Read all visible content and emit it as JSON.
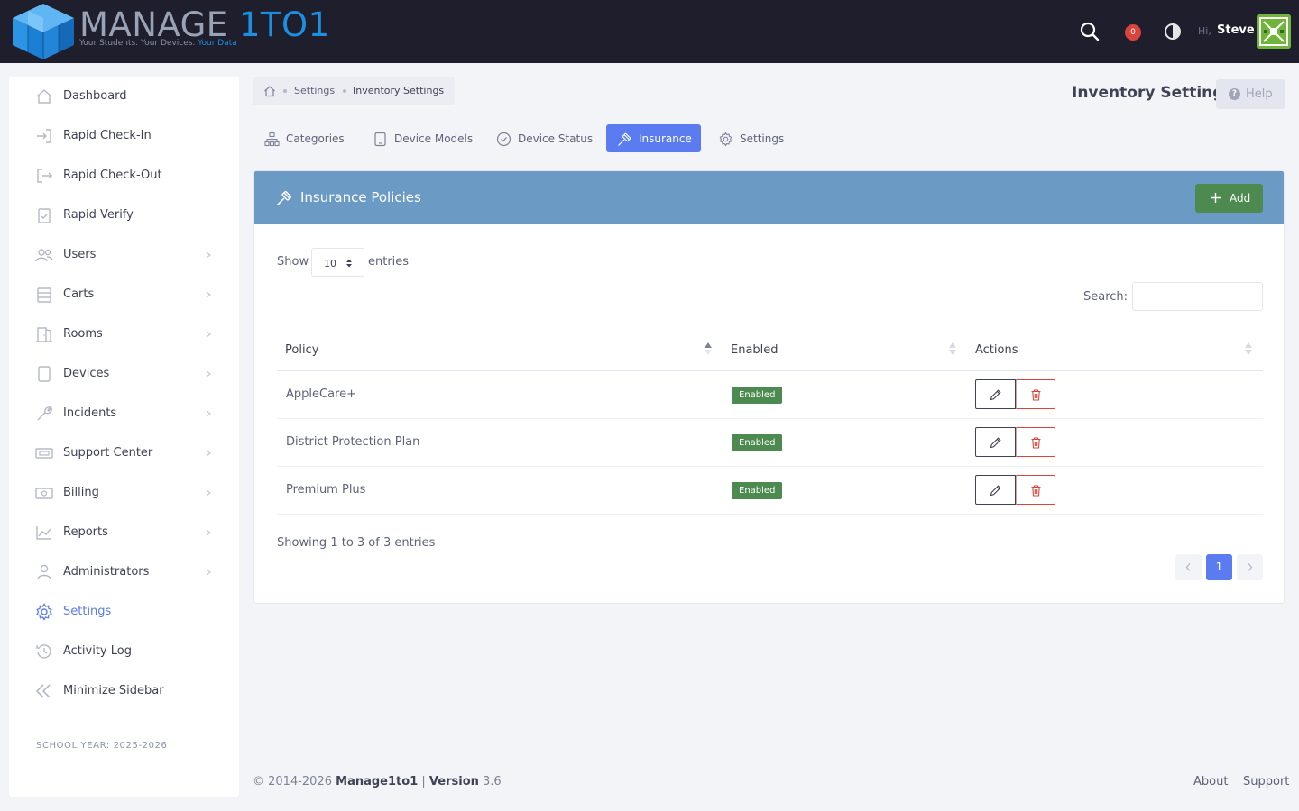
{
  "app": {
    "logo_main": "MANAGE",
    "logo_accent": "1TO1",
    "tagline_main": "Your Students. Your Devices.",
    "tagline_accent": "Your Data"
  },
  "topbar": {
    "notification_count": "0",
    "greeting": "Hi,",
    "user_name": "Steve"
  },
  "sidebar": {
    "items": [
      {
        "label": "Dashboard",
        "icon": "home-icon",
        "has_children": false
      },
      {
        "label": "Rapid Check-In",
        "icon": "sign-in-icon",
        "has_children": false
      },
      {
        "label": "Rapid Check-Out",
        "icon": "sign-out-icon",
        "has_children": false
      },
      {
        "label": "Rapid Verify",
        "icon": "clipboard-check-icon",
        "has_children": false
      },
      {
        "label": "Users",
        "icon": "users-icon",
        "has_children": true
      },
      {
        "label": "Carts",
        "icon": "cart-icon",
        "has_children": true
      },
      {
        "label": "Rooms",
        "icon": "door-icon",
        "has_children": true
      },
      {
        "label": "Devices",
        "icon": "tablet-icon",
        "has_children": true
      },
      {
        "label": "Incidents",
        "icon": "wrench-icon",
        "has_children": true
      },
      {
        "label": "Support Center",
        "icon": "ticket-icon",
        "has_children": true
      },
      {
        "label": "Billing",
        "icon": "money-icon",
        "has_children": true
      },
      {
        "label": "Reports",
        "icon": "chart-icon",
        "has_children": true
      },
      {
        "label": "Administrators",
        "icon": "admin-icon",
        "has_children": true
      },
      {
        "label": "Settings",
        "icon": "gear-icon",
        "has_children": false,
        "active": true
      },
      {
        "label": "Activity Log",
        "icon": "history-icon",
        "has_children": false
      },
      {
        "label": "Minimize Sidebar",
        "icon": "double-chevron-left-icon",
        "has_children": false
      }
    ],
    "school_year": "SCHOOL YEAR: 2025-2026"
  },
  "breadcrumb": {
    "items": [
      "Settings"
    ],
    "current": "Inventory Settings"
  },
  "page": {
    "title": "Inventory Settings",
    "help_label": "Help"
  },
  "tabs": [
    {
      "label": "Categories",
      "icon": "sitemap-icon"
    },
    {
      "label": "Device Models",
      "icon": "tablet-icon"
    },
    {
      "label": "Device Status",
      "icon": "check-circle-icon"
    },
    {
      "label": "Insurance",
      "icon": "gavel-icon",
      "active": true
    },
    {
      "label": "Settings",
      "icon": "gear-icon"
    }
  ],
  "card": {
    "title": "Insurance Policies",
    "add_label": "Add"
  },
  "table": {
    "show_label": "Show",
    "entries_value": "10",
    "entries_label": "entries",
    "search_label": "Search:",
    "search_value": "",
    "columns": [
      "Policy",
      "Enabled",
      "Actions"
    ],
    "rows": [
      {
        "policy": "AppleCare+",
        "enabled": "Enabled"
      },
      {
        "policy": "District Protection Plan",
        "enabled": "Enabled"
      },
      {
        "policy": "Premium Plus",
        "enabled": "Enabled"
      }
    ],
    "info": "Showing 1 to 3 of 3 entries",
    "current_page": "1"
  },
  "footer": {
    "copyright": "© 2014-2026",
    "brand": "Manage1to1",
    "separator": "|",
    "version_label": "Version",
    "version": "3.6",
    "links": [
      "About",
      "Support"
    ]
  },
  "colors": {
    "topbar": "#1e1e2d",
    "accent": "#5b7bf0",
    "card_header": "#6b9ac4",
    "success": "#4c8a4f",
    "danger": "#d9453c"
  }
}
